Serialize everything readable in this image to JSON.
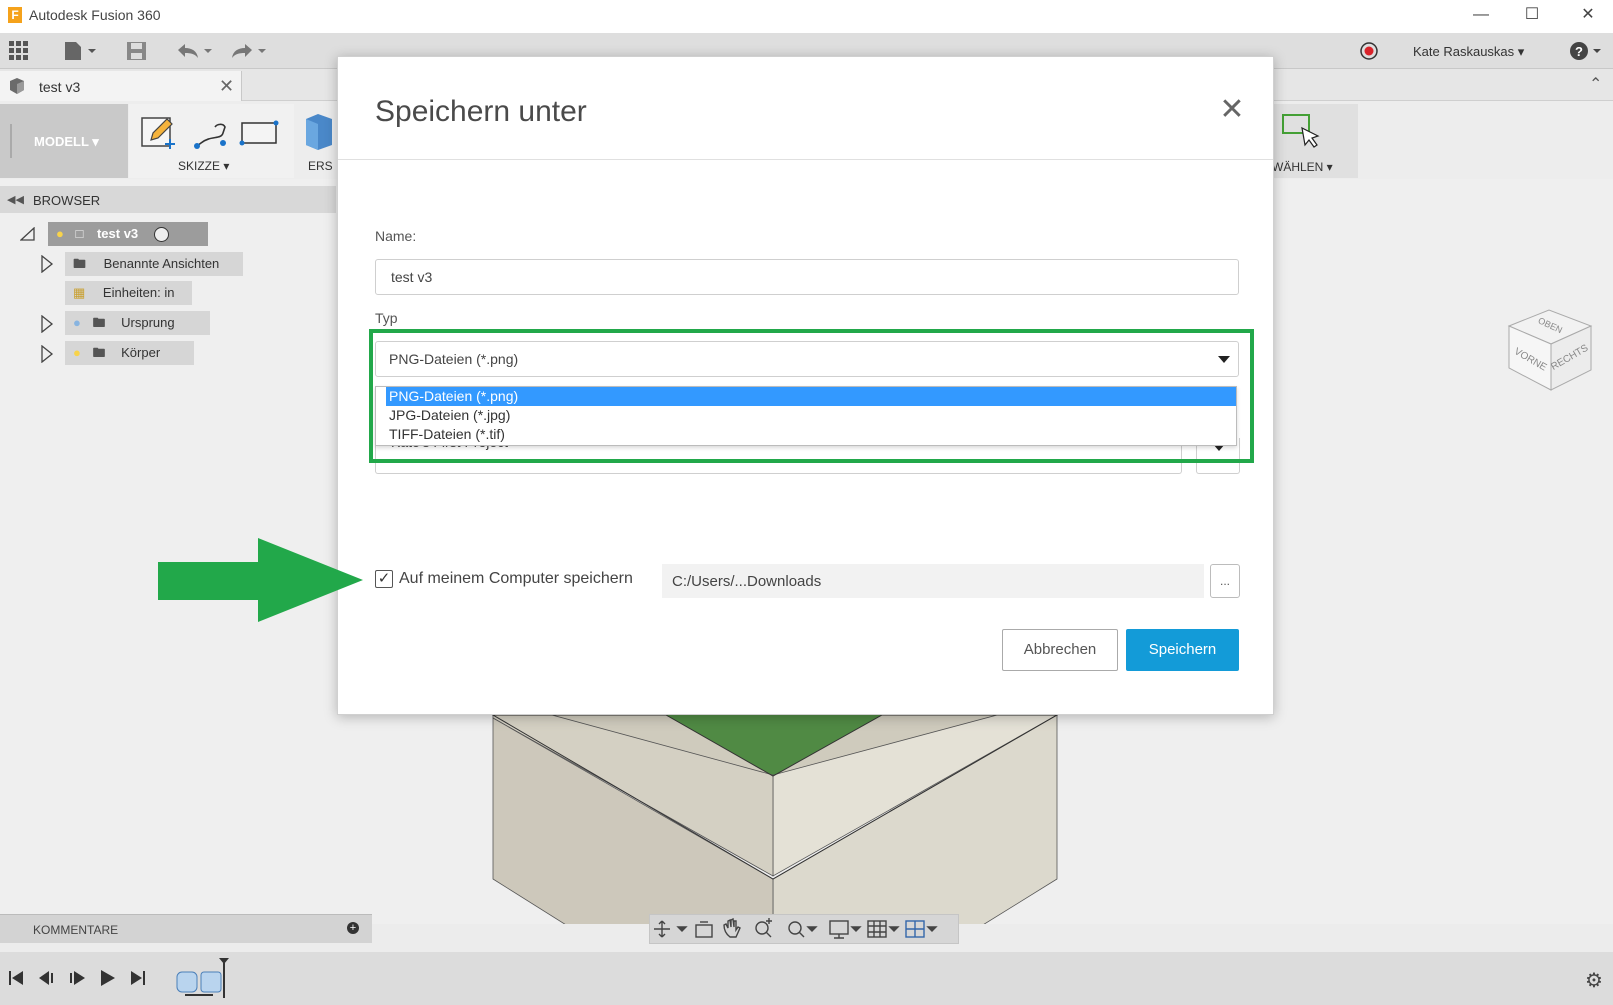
{
  "window": {
    "title": "Autodesk Fusion 360",
    "logo_letter": "F"
  },
  "qat": {
    "user_name": "Kate Raskauskas ▾"
  },
  "document_tab": {
    "title": "test v3"
  },
  "ribbon": {
    "workspace": "MODELL ▾",
    "sketch": "SKIZZE ▾",
    "create": "ERS",
    "select": "WÄHLEN ▾"
  },
  "viewcube": {
    "top": "OBEN",
    "front": "VORNE",
    "right": "RECHTS"
  },
  "browser": {
    "title": "BROWSER",
    "root": "test v3",
    "items": [
      "Benannte Ansichten",
      "Einheiten: in",
      "Ursprung",
      "Körper"
    ]
  },
  "comments": {
    "label": "KOMMENTARE"
  },
  "dialog": {
    "title": "Speichern unter",
    "name_label": "Name:",
    "name_value": "test v3",
    "type_label": "Typ",
    "type_selected": "PNG-Dateien (*.png)",
    "type_options": [
      "PNG-Dateien (*.png)",
      "JPG-Dateien (*.jpg)",
      "TIFF-Dateien (*.tif)"
    ],
    "project_value": "Kate's First Project",
    "local_save_label": "Auf meinem Computer speichern",
    "local_save_checked": true,
    "path_value": "C:/Users/...Downloads",
    "browse_label": "...",
    "cancel_label": "Abbrechen",
    "save_label": "Speichern"
  },
  "colors": {
    "accent": "#139bd8",
    "highlight": "#22a84a",
    "selection": "#3399ff",
    "model_top": "#508a44",
    "model_side": "#d2cec0"
  }
}
